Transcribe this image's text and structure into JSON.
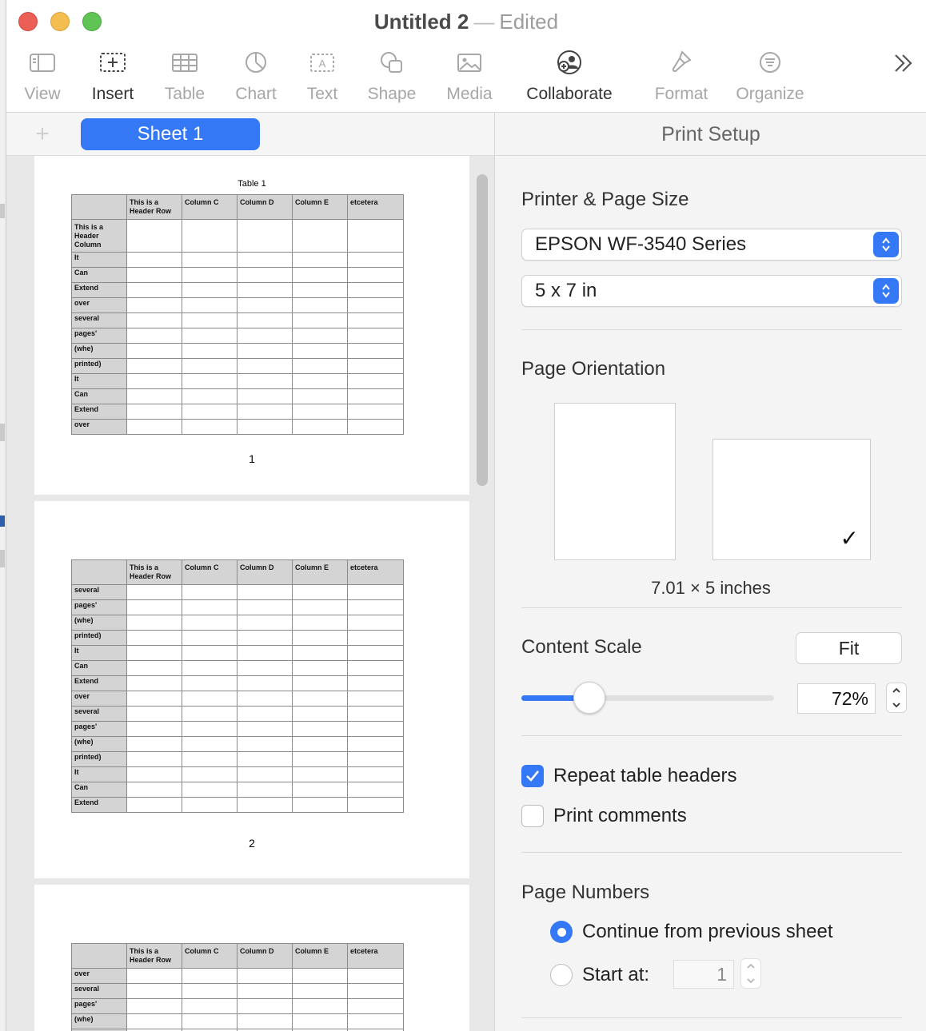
{
  "window": {
    "title": "Untitled 2",
    "separator": "—",
    "status": "Edited"
  },
  "toolbar": {
    "items": [
      {
        "label": "View",
        "icon": "sidebar-view-icon",
        "active": false
      },
      {
        "label": "Insert",
        "icon": "insert-icon",
        "active": true
      },
      {
        "label": "Table",
        "icon": "table-icon",
        "active": false
      },
      {
        "label": "Chart",
        "icon": "chart-icon",
        "active": false
      },
      {
        "label": "Text",
        "icon": "text-box-icon",
        "active": false
      },
      {
        "label": "Shape",
        "icon": "shape-icon",
        "active": false
      },
      {
        "label": "Media",
        "icon": "media-icon",
        "active": false
      },
      {
        "label": "Collaborate",
        "icon": "collaborate-icon",
        "active": true
      },
      {
        "label": "Format",
        "icon": "format-brush-icon",
        "active": false
      },
      {
        "label": "Organize",
        "icon": "organize-icon",
        "active": false
      }
    ],
    "overflow_icon": "chevron-double-right-icon"
  },
  "sheets": {
    "add_icon": "plus-icon",
    "active_tab": "Sheet 1"
  },
  "preview": {
    "table_caption": "Table 1",
    "header_cells": [
      "",
      "This is a Header Row",
      "Column C",
      "Column D",
      "Column E",
      "etcetera"
    ],
    "header_column_label": "This is a Header Column",
    "pages": [
      {
        "number": "1",
        "rows": [
          "It",
          "Can",
          "Extend",
          "over",
          " several",
          "pages'",
          "(whe)",
          "printed)",
          "It",
          "Can",
          "Extend",
          "over"
        ]
      },
      {
        "number": "2",
        "rows": [
          " several",
          "pages'",
          "(whe)",
          "printed)",
          "It",
          "Can",
          "Extend",
          "over",
          " several",
          "pages'",
          "(whe)",
          "printed)",
          "It",
          "Can",
          "Extend"
        ]
      },
      {
        "number": "",
        "rows": [
          "over",
          " several",
          "pages'",
          "(whe)",
          ""
        ]
      }
    ]
  },
  "print_setup": {
    "header": "Print Setup",
    "printer_section": "Printer & Page Size",
    "printer": "EPSON WF-3540 Series",
    "paper_size": "5 x 7 in",
    "orientation_section": "Page Orientation",
    "orientation_selected": "landscape",
    "dimensions": "7.01 × 5 inches",
    "content_scale_section": "Content Scale",
    "fit_label": "Fit",
    "scale_value": "72%",
    "scale_fraction": 0.27,
    "repeat_headers_label": "Repeat table headers",
    "repeat_headers_checked": true,
    "print_comments_label": "Print comments",
    "print_comments_checked": false,
    "page_numbers_section": "Page Numbers",
    "continue_label": "Continue from previous sheet",
    "start_at_label": "Start at:",
    "start_at_value": "1",
    "selected_numbering": "continue"
  },
  "colors": {
    "accent": "#3478f6",
    "close": "#ec5f56",
    "minimize": "#f4bd4f",
    "zoom": "#5fc454"
  }
}
